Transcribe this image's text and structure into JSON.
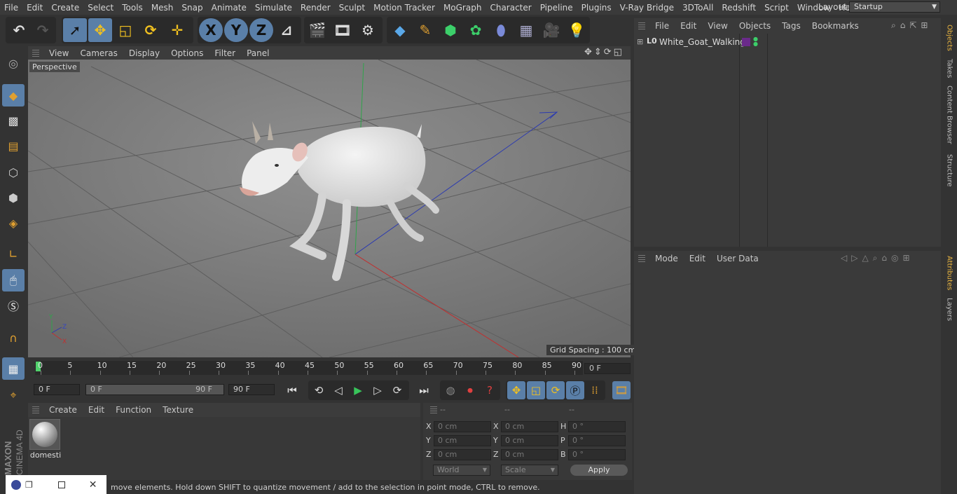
{
  "menu": [
    "File",
    "Edit",
    "Create",
    "Select",
    "Tools",
    "Mesh",
    "Snap",
    "Animate",
    "Simulate",
    "Render",
    "Sculpt",
    "Motion Tracker",
    "MoGraph",
    "Character",
    "Pipeline",
    "Plugins",
    "V-Ray Bridge",
    "3DToAll",
    "Redshift",
    "Script",
    "Window",
    "Help"
  ],
  "layout": {
    "label": "Layout:",
    "value": "Startup"
  },
  "toolbar": {
    "x_label": "X",
    "y_label": "Y",
    "z_label": "Z"
  },
  "viewport": {
    "menu": [
      "View",
      "Cameras",
      "Display",
      "Options",
      "Filter",
      "Panel"
    ],
    "camera_label": "Perspective",
    "grid_spacing": "Grid Spacing : 100 cm",
    "axis_x": "X",
    "axis_y": "Y",
    "axis_z": "Z"
  },
  "timeline": {
    "ticks": [
      "0",
      "5",
      "10",
      "15",
      "20",
      "25",
      "30",
      "35",
      "40",
      "45",
      "50",
      "55",
      "60",
      "65",
      "70",
      "75",
      "80",
      "85",
      "90"
    ],
    "current_frame": "0 F",
    "start_field": "0 F",
    "range_start": "0 F",
    "range_end": "90 F",
    "end_field": "90 F"
  },
  "materials": {
    "menu": [
      "Create",
      "Edit",
      "Function",
      "Texture"
    ],
    "items": [
      {
        "name": "domesti"
      }
    ]
  },
  "coords": {
    "headers": [
      "--",
      "--",
      "--"
    ],
    "rows": [
      {
        "l1": "X",
        "v1": "0 cm",
        "l2": "X",
        "v2": "0 cm",
        "l3": "H",
        "v3": "0 °"
      },
      {
        "l1": "Y",
        "v1": "0 cm",
        "l2": "Y",
        "v2": "0 cm",
        "l3": "P",
        "v3": "0 °"
      },
      {
        "l1": "Z",
        "v1": "0 cm",
        "l2": "Z",
        "v2": "0 cm",
        "l3": "B",
        "v3": "0 °"
      }
    ],
    "mode_world": "World",
    "mode_scale": "Scale",
    "apply": "Apply"
  },
  "objects": {
    "menu": [
      "File",
      "Edit",
      "View",
      "Objects",
      "Tags",
      "Bookmarks"
    ],
    "items": [
      {
        "name": "White_Goat_Walking",
        "layer_icon": "L0"
      }
    ]
  },
  "attributes": {
    "menu": [
      "Mode",
      "Edit",
      "User Data"
    ]
  },
  "side_tabs": [
    "Objects",
    "Takes",
    "Content Browser",
    "Structure",
    "Attributes",
    "Layers"
  ],
  "status": "move elements. Hold down SHIFT to quantize movement / add to the selection in point mode, CTRL to remove.",
  "brand": {
    "line1": "MAXON",
    "line2": "CINEMA 4D"
  },
  "colors": {
    "accent": "#5b9bd5",
    "selected_tool": "#6a8fb5",
    "x_axis": "#c0392b",
    "y_axis": "#27ae60",
    "z_axis": "#2e3aa8",
    "timeline_marker": "#4fd16b",
    "play_green": "#38c45a"
  }
}
